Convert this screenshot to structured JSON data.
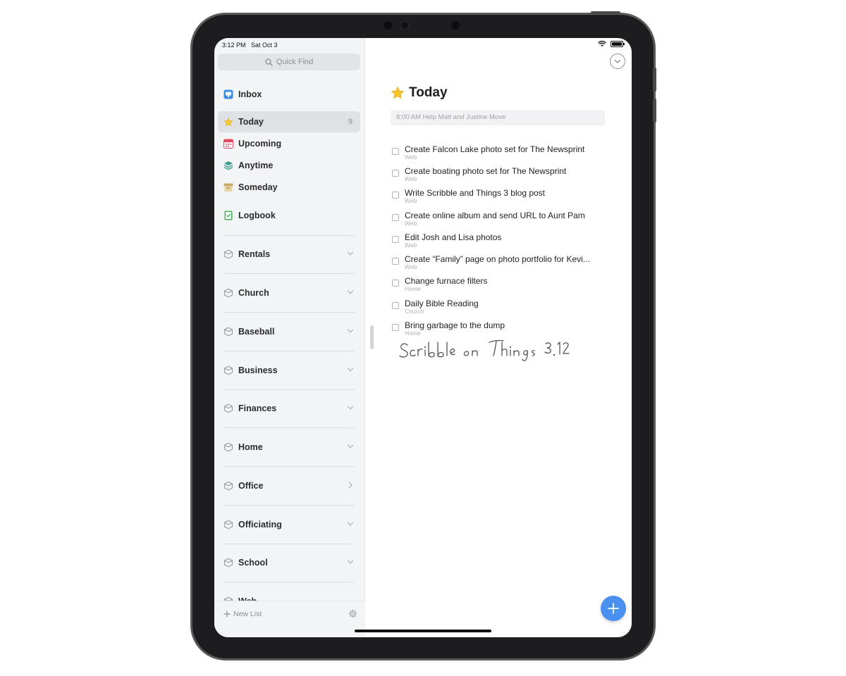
{
  "status_bar": {
    "time": "3:12 PM",
    "date": "Sat Oct 3"
  },
  "sidebar": {
    "search_placeholder": "Quick Find",
    "nav": [
      {
        "label": "Inbox",
        "icon": "inbox-icon",
        "color": "#3b8fe0"
      },
      {
        "label": "Today",
        "icon": "star-icon",
        "color": "#f6c42d",
        "count": "9",
        "selected": true
      },
      {
        "label": "Upcoming",
        "icon": "calendar-icon",
        "color": "#e8455f"
      },
      {
        "label": "Anytime",
        "icon": "layers-icon",
        "color": "#3d9c8f"
      },
      {
        "label": "Someday",
        "icon": "archive-box-icon",
        "color": "#d3b87a"
      },
      {
        "label": "Logbook",
        "icon": "logbook-icon",
        "color": "#45b25a"
      }
    ],
    "areas": [
      {
        "label": "Rentals",
        "expanded": true
      },
      {
        "label": "Church",
        "expanded": true
      },
      {
        "label": "Baseball",
        "expanded": true
      },
      {
        "label": "Business",
        "expanded": true
      },
      {
        "label": "Finances",
        "expanded": true
      },
      {
        "label": "Home",
        "expanded": true
      },
      {
        "label": "Office",
        "expanded": false
      },
      {
        "label": "Officiating",
        "expanded": true
      },
      {
        "label": "School",
        "expanded": true
      },
      {
        "label": "Web",
        "expanded": true
      }
    ],
    "new_list_label": "New List"
  },
  "main": {
    "title": "Today",
    "title_icon": "star-icon",
    "calendar_event": "8:00 AM Help Matt and Justine Move",
    "tasks": [
      {
        "title": "Create Falcon Lake photo set for The Newsprint",
        "area": "Web"
      },
      {
        "title": "Create boating photo set for The Newsprint",
        "area": "Web"
      },
      {
        "title": "Write Scribble and Things 3 blog post",
        "area": "Web"
      },
      {
        "title": "Create online album and send URL to Aunt Pam",
        "area": "Web"
      },
      {
        "title": "Edit Josh and Lisa photos",
        "area": "Web"
      },
      {
        "title": "Create “Family” page on photo portfolio for Kevi...",
        "area": "Web"
      },
      {
        "title": "Change furnace filters",
        "area": "Home"
      },
      {
        "title": "Daily Bible Reading",
        "area": "Church"
      },
      {
        "title": "Bring garbage to the dump",
        "area": "Home"
      }
    ],
    "handwriting": "Scribble on Things 3.12"
  },
  "colors": {
    "accent": "#4a90f0",
    "sidebar_bg": "#f3f4f6",
    "device_frame": "#1d1d1f"
  }
}
